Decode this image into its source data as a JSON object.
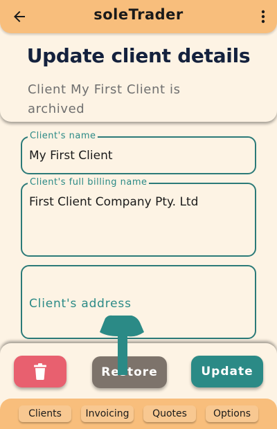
{
  "app": {
    "title": "soleTrader"
  },
  "header": {
    "page_title": "Update client details",
    "status_text": "Client My First Client is archived"
  },
  "form": {
    "name": {
      "label": "Client's name",
      "value": "My First Client"
    },
    "billing": {
      "label": "Client's full billing name",
      "value": "First Client Company Pty. Ltd"
    },
    "address": {
      "placeholder": "Client's address"
    }
  },
  "actions": {
    "restore_label": "Restore",
    "update_label": "Update"
  },
  "nav": {
    "items": [
      {
        "label": "Clients"
      },
      {
        "label": "Invoicing"
      },
      {
        "label": "Quotes"
      },
      {
        "label": "Options"
      }
    ]
  },
  "colors": {
    "appbar": "#f8be7c",
    "background": "#fdf3e4",
    "accent": "#2b8a86",
    "delete": "#e8606f",
    "restore": "#7d736b"
  },
  "icons": [
    "back-arrow-icon",
    "more-vert-icon",
    "trash-icon",
    "pointing-hand-icon"
  ]
}
